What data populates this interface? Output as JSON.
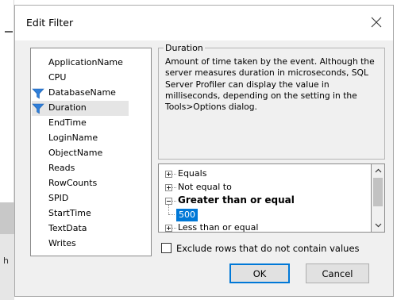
{
  "dialog": {
    "title": "Edit Filter",
    "close_icon": "close-icon"
  },
  "background": {
    "partial_letter": "h"
  },
  "columns": {
    "items": [
      {
        "label": "ApplicationName",
        "filtered": false,
        "selected": false
      },
      {
        "label": "CPU",
        "filtered": false,
        "selected": false
      },
      {
        "label": "DatabaseName",
        "filtered": true,
        "selected": false
      },
      {
        "label": "Duration",
        "filtered": true,
        "selected": true
      },
      {
        "label": "EndTime",
        "filtered": false,
        "selected": false
      },
      {
        "label": "LoginName",
        "filtered": false,
        "selected": false
      },
      {
        "label": "ObjectName",
        "filtered": false,
        "selected": false
      },
      {
        "label": "Reads",
        "filtered": false,
        "selected": false
      },
      {
        "label": "RowCounts",
        "filtered": false,
        "selected": false
      },
      {
        "label": "SPID",
        "filtered": false,
        "selected": false
      },
      {
        "label": "StartTime",
        "filtered": false,
        "selected": false
      },
      {
        "label": "TextData",
        "filtered": false,
        "selected": false
      },
      {
        "label": "Writes",
        "filtered": false,
        "selected": false
      }
    ],
    "filter_icon": "funnel-icon"
  },
  "description": {
    "legend": "Duration",
    "text": "Amount of time taken by the event. Although the server measures duration in microseconds, SQL Server Profiler can display the value in milliseconds, depending on the setting in the Tools>Options dialog."
  },
  "operators": {
    "equals": "Equals",
    "not_equal": "Not equal to",
    "greater_equal": "Greater than or equal",
    "greater_equal_value": "500",
    "less_equal": "Less than or equal"
  },
  "exclude_checkbox": {
    "label": "Exclude rows that do not contain values",
    "checked": false
  },
  "buttons": {
    "ok": "OK",
    "cancel": "Cancel"
  },
  "colors": {
    "selection_blue": "#0078d7",
    "funnel_blue": "#2f7ed8"
  }
}
